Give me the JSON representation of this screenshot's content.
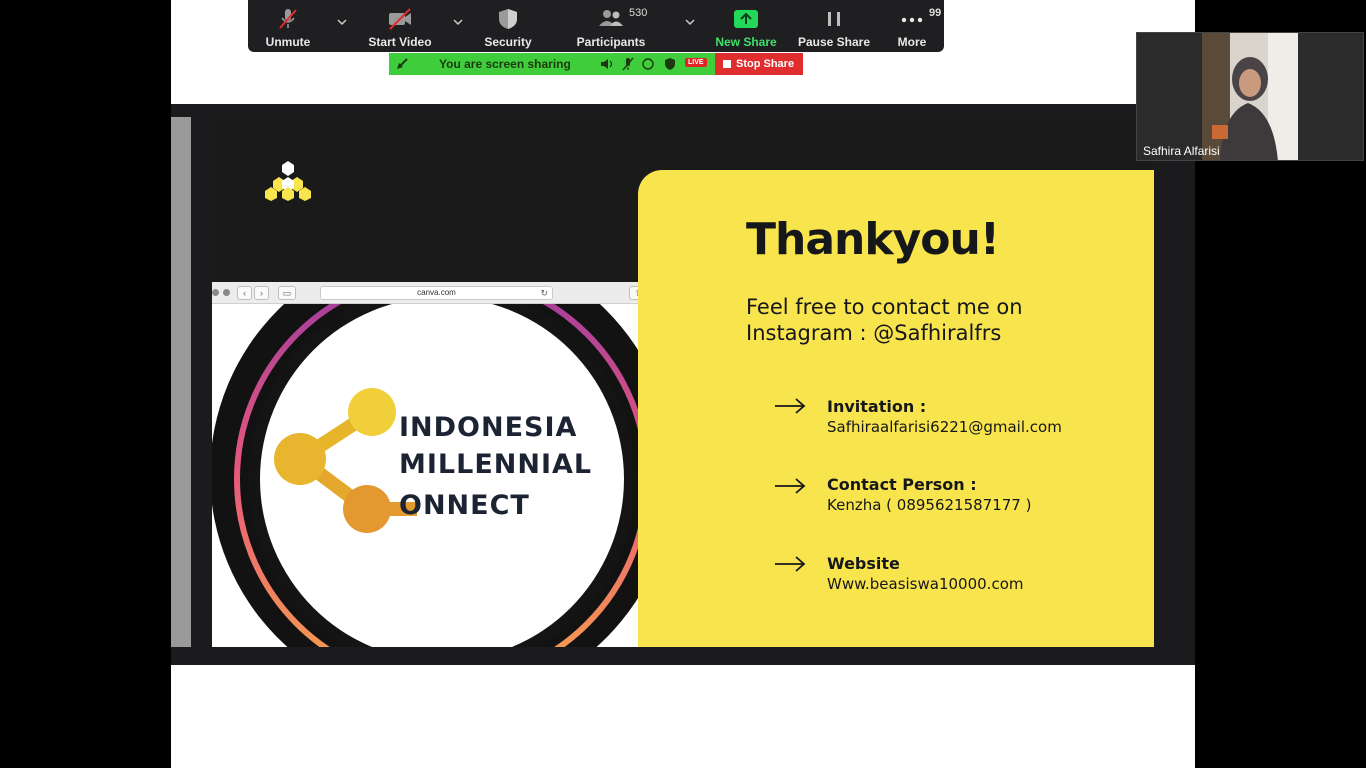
{
  "toolbar": {
    "unmute": "Unmute",
    "start_video": "Start Video",
    "security": "Security",
    "participants": "Participants",
    "participants_count": "530",
    "new_share": "New Share",
    "pause_share": "Pause Share",
    "more": "More",
    "more_count": "99"
  },
  "share_bar": {
    "status": "You are screen sharing",
    "live_badge": "LIVE",
    "stop_share": "Stop Share"
  },
  "video": {
    "participant_name": "Safhira Alfarisi"
  },
  "slide": {
    "browser_url": "canva.com",
    "logo_lines": [
      "INDONESIA",
      "MILLENNIAL",
      "ONNECT"
    ],
    "title": "Thankyou!",
    "subtitle_line1": "Feel free to contact me on",
    "subtitle_line2": "Instagram : @Safhiralfrs",
    "contacts": [
      {
        "title": "Invitation :",
        "value": "Safhiraalfarisi6221@gmail.com"
      },
      {
        "title": "Contact Person :",
        "value": "Kenzha ( 0895621587177 )"
      },
      {
        "title": "Website",
        "value": "Www.beasiswa10000.com"
      }
    ]
  },
  "colors": {
    "card_yellow": "#f8e44c",
    "share_green": "#3fcd3b",
    "stop_red": "#e02d2d",
    "new_share_green": "#23d959"
  },
  "icons": {
    "unmute": "muted-mic-icon",
    "start_video": "video-off-icon",
    "security": "shield-icon",
    "participants": "people-icon",
    "new_share": "upload-arrow-icon",
    "pause_share": "pause-icon",
    "more": "ellipsis-icon"
  }
}
